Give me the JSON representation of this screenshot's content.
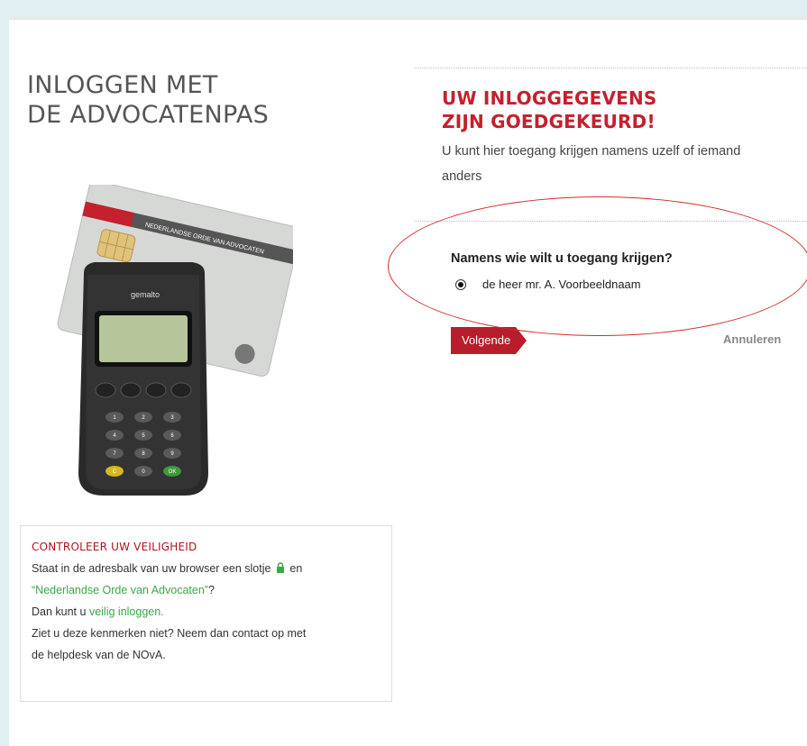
{
  "page": {
    "title_line1": "INLOGGEN MET",
    "title_line2": "DE ADVOCATENPAS"
  },
  "card": {
    "band_text": "NEDERLANDSE ORDE VAN ADVOCATEN",
    "reader_brand": "gemalto",
    "keypad_keys": [
      "1",
      "2",
      "3",
      "4",
      "5",
      "6",
      "7",
      "8",
      "9",
      "C",
      "0",
      "OK"
    ]
  },
  "security": {
    "title": "CONTROLEER UW VEILIGHEID",
    "line1_a": "Staat in de adresbalk van uw browser een slotje",
    "line1_b": "en",
    "line2_link": "“Nederlandse Orde van Advocaten”",
    "line2_b": "?",
    "line3_a": "Dan kunt u",
    "line3_link": "veilig inloggen.",
    "line4": "Ziet u deze kenmerken niet? Neem dan contact op met",
    "line5": "de helpdesk van de NOvA."
  },
  "result": {
    "title_line1": "UW INLOGGEGEVENS",
    "title_line2": "ZIJN GOEDGEKEURD!",
    "subtitle": "U kunt hier toegang krijgen namens uzelf of iemand anders",
    "question": "Namens wie wilt u toegang krijgen?",
    "option_label": "de heer mr. A. Voorbeeldnaam",
    "option_selected": true,
    "next_label": "Volgende",
    "cancel_label": "Annuleren"
  },
  "colors": {
    "accent_red": "#b81d2b",
    "link_green": "#3aa843",
    "background": "#dfeff2"
  }
}
